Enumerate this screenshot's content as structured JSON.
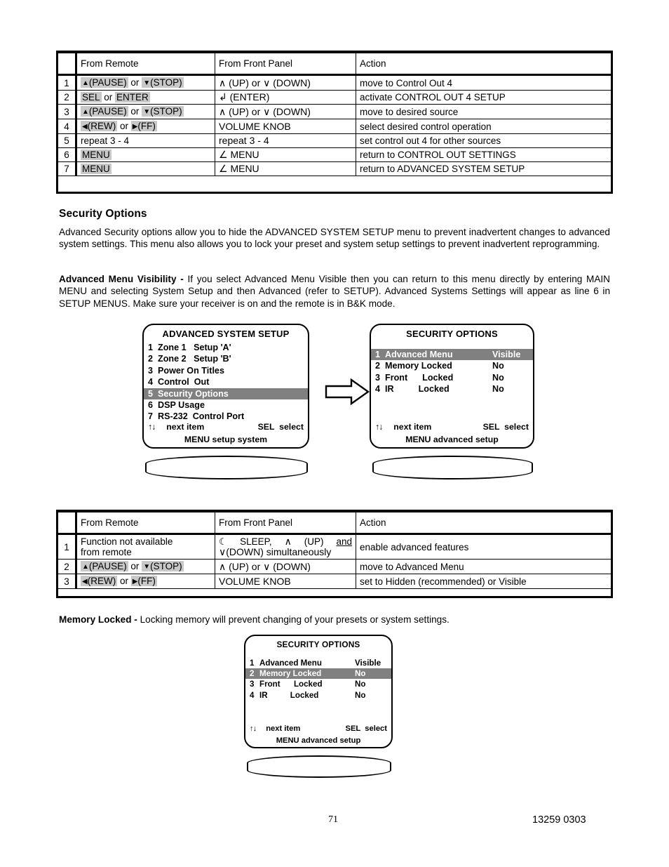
{
  "section": {
    "heading": "Security Options",
    "intro": "Advanced Security options allow you to hide the ADVANCED SYSTEM SETUP menu to prevent inadvertent changes to advanced system settings. This menu also allows you to lock your preset and system setup settings to prevent inadvertent reprogramming.",
    "visibility_label": "Advanced Menu Visibility - ",
    "visibility_text": "If you select Advanced Menu Visible then you can return to this menu directly by entering MAIN MENU and selecting System Setup and then Advanced (refer to SETUP). Advanced Systems Settings will appear as line 6 in SETUP MENUS. Make sure your receiver is on and the remote is in B&K mode.",
    "memory_locked_label": "Memory Locked - ",
    "memory_locked_text": "Locking memory will prevent changing of your presets or system settings."
  },
  "table_top": {
    "headers": {
      "num": "",
      "remote": "From Remote",
      "front": "From Front Panel",
      "action": "Action"
    },
    "rows": [
      {
        "num": "1",
        "remote": {
          "type": "keys",
          "k1": "(PAUSE)",
          "sym1": "▲",
          "mid": " or ",
          "k2": "(STOP)",
          "sym2": "▼"
        },
        "front": "∧ (UP) or ∨ (DOWN)",
        "action": "move to Control Out 4"
      },
      {
        "num": "2",
        "remote": {
          "type": "keys2",
          "k1": "SEL",
          "mid": " or ",
          "k2": "ENTER"
        },
        "front": "↲ (ENTER)",
        "action": "activate CONTROL OUT 4 SETUP"
      },
      {
        "num": "3",
        "remote": {
          "type": "keys",
          "k1": "(PAUSE)",
          "sym1": "▲",
          "mid": " or ",
          "k2": "(STOP)",
          "sym2": "▼"
        },
        "front": "∧ (UP) or ∨ (DOWN)",
        "action": "move to desired source"
      },
      {
        "num": "4",
        "remote": {
          "type": "keys",
          "k1": "(REW)",
          "sym1": "◀",
          "mid": " or ",
          "k2": "(FF)",
          "sym2": "▶"
        },
        "front": "VOLUME KNOB",
        "action": "select desired control operation"
      },
      {
        "num": "5",
        "remote": {
          "type": "plain",
          "text": "repeat 3 - 4"
        },
        "front": "repeat 3 - 4",
        "action": "set control out 4 for other sources"
      },
      {
        "num": "6",
        "remote": {
          "type": "single",
          "k1": "MENU"
        },
        "front": "∠ MENU",
        "action": "return to CONTROL OUT SETTINGS"
      },
      {
        "num": "7",
        "remote": {
          "type": "single",
          "k1": "MENU"
        },
        "front": "∠ MENU",
        "action": "return to ADVANCED SYSTEM SETUP"
      }
    ]
  },
  "table_bottom": {
    "headers": {
      "num": "",
      "remote": "From Remote",
      "front": "From Front Panel",
      "action": "Action"
    },
    "rows": [
      {
        "num": "1",
        "remote": {
          "type": "plain2",
          "line1": "Function not available",
          "line2": "from remote"
        },
        "front_line1_a": "☾",
        "front_line1_b": "SLEEP,",
        "front_line1_c": "∧",
        "front_line1_d": "(UP)",
        "front_line1_e": "and",
        "front_line2": "∨(DOWN) simultaneously",
        "action": "enable advanced features"
      },
      {
        "num": "2",
        "remote": {
          "type": "keys",
          "k1": "(PAUSE)",
          "sym1": "▲",
          "mid": " or ",
          "k2": "(STOP)",
          "sym2": "▼"
        },
        "front": "∧ (UP) or ∨ (DOWN)",
        "action": "move to Advanced Menu"
      },
      {
        "num": "3",
        "remote": {
          "type": "keys",
          "k1": "(REW)",
          "sym1": "◀",
          "mid": " or ",
          "k2": "(FF)",
          "sym2": "▶"
        },
        "front": "VOLUME KNOB",
        "action": "set to Hidden (recommended) or Visible"
      }
    ]
  },
  "osd_advanced": {
    "title": "ADVANCED SYSTEM SETUP",
    "items": [
      {
        "num": "1",
        "label": "Zone 1   Setup 'A'",
        "value": "",
        "selected": false
      },
      {
        "num": "2",
        "label": "Zone 2   Setup 'B'",
        "value": "",
        "selected": false
      },
      {
        "num": "3",
        "label": "Power On Titles",
        "value": "",
        "selected": false
      },
      {
        "num": "4",
        "label": "Control  Out",
        "value": "",
        "selected": false
      },
      {
        "num": "5",
        "label": "Security Options",
        "value": "",
        "selected": true
      },
      {
        "num": "6",
        "label": "DSP Usage",
        "value": "",
        "selected": false
      },
      {
        "num": "7",
        "label": "RS-232  Control Port",
        "value": "",
        "selected": false
      }
    ],
    "foot_arrows": "↑↓",
    "foot_next": "next item",
    "foot_sel": "SEL  select",
    "foot_menu": "MENU setup system"
  },
  "osd_security_1": {
    "title": "SECURITY OPTIONS",
    "items": [
      {
        "num": "1",
        "label": "Advanced Menu",
        "value": "Visible",
        "selected": true
      },
      {
        "num": "2",
        "label": "Memory Locked",
        "value": "No",
        "selected": false
      },
      {
        "num": "3",
        "label": "Front      Locked",
        "value": "No",
        "selected": false
      },
      {
        "num": "4",
        "label": "IR          Locked",
        "value": "No",
        "selected": false
      }
    ],
    "foot_arrows": "↑↓",
    "foot_next": "next item",
    "foot_sel": "SEL  select",
    "foot_menu": "MENU advanced setup"
  },
  "osd_security_2": {
    "title": "SECURITY OPTIONS",
    "items": [
      {
        "num": "1",
        "label": "Advanced Menu",
        "value": "Visible",
        "selected": false
      },
      {
        "num": "2",
        "label": "Memory Locked",
        "value": "No",
        "selected": true
      },
      {
        "num": "3",
        "label": "Front      Locked",
        "value": "No",
        "selected": false
      },
      {
        "num": "4",
        "label": "IR          Locked",
        "value": "No",
        "selected": false
      }
    ],
    "foot_arrows": "↑↓",
    "foot_next": "next item",
    "foot_sel": "SEL  select",
    "foot_menu": "MENU advanced setup"
  },
  "flow_arrow": "right-arrow",
  "footer": {
    "page_number": "71",
    "doc_code": "13259 0303"
  },
  "colors": {
    "highlight_bg": "#808080",
    "key_bg": "#c8c8c8",
    "ink": "#000000",
    "paper": "#ffffff"
  }
}
